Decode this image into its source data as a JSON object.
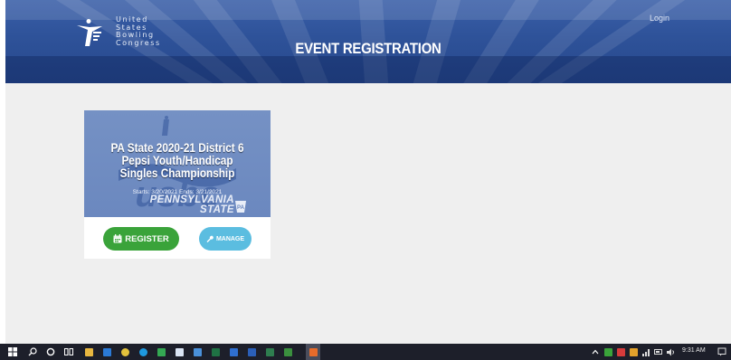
{
  "header": {
    "logo_lines": [
      "United",
      "States",
      "Bowling",
      "Congress"
    ],
    "title": "EVENT REGISTRATION",
    "login_label": "Login"
  },
  "event_card": {
    "title": "PA State 2020-21 District 6 Pepsi Youth/Handicap Singles Championship",
    "dates": "Starts: 3/20/2021  Ends: 3/21/2021",
    "state_line1": "PENNSYLVANIA",
    "state_line2": "STATE",
    "register_label": "REGISTER",
    "manage_label": "MANAGE",
    "colors": {
      "register": "#3aa33a",
      "manage": "#5bbde0",
      "banner": "#2e5299"
    }
  },
  "taskbar": {
    "apps": [
      "start-icon",
      "search-icon",
      "cortana-icon",
      "task-view-icon",
      "file-explorer-icon",
      "edge-icon",
      "chrome-icon",
      "store-icon",
      "excel-icon",
      "word-icon",
      "photos-icon",
      "mail-icon",
      "app-icon",
      "app-icon",
      "app-icon"
    ],
    "time": "9:31 AM"
  }
}
